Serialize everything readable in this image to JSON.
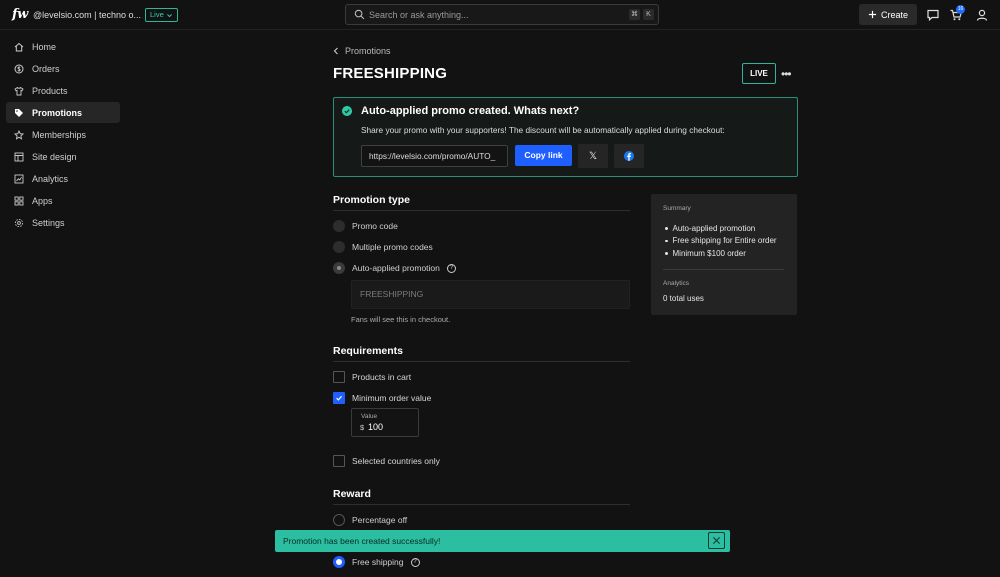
{
  "topbar": {
    "account": "@levelsio.com | techno o...",
    "status_pill": "Live",
    "search_placeholder": "Search or ask anything...",
    "shortcut_keys": [
      "⌘",
      "K"
    ],
    "create_label": "Create",
    "cart_count": "16"
  },
  "sidebar": {
    "items": [
      {
        "label": "Home",
        "icon": "home-icon"
      },
      {
        "label": "Orders",
        "icon": "dollar-icon"
      },
      {
        "label": "Products",
        "icon": "shirt-icon"
      },
      {
        "label": "Promotions",
        "icon": "tag-icon",
        "active": true
      },
      {
        "label": "Memberships",
        "icon": "star-icon"
      },
      {
        "label": "Site design",
        "icon": "layout-icon"
      },
      {
        "label": "Analytics",
        "icon": "chart-icon"
      },
      {
        "label": "Apps",
        "icon": "grid-icon"
      },
      {
        "label": "Settings",
        "icon": "gear-icon"
      }
    ]
  },
  "header": {
    "breadcrumb": "Promotions",
    "title": "FREESHIPPING",
    "live_label": "LIVE"
  },
  "banner": {
    "title": "Auto-applied promo created. Whats next?",
    "description": "Share your promo with your supporters! The discount will be automatically applied during checkout:",
    "url": "https://levelsio.com/promo/AUTO_",
    "copy_label": "Copy link"
  },
  "promotion_type": {
    "title": "Promotion type",
    "options": [
      "Promo code",
      "Multiple promo codes",
      "Auto-applied promotion"
    ],
    "selected": "Auto-applied promotion",
    "code_placeholder": "FREESHIPPING",
    "hint": "Fans will see this in checkout."
  },
  "requirements": {
    "title": "Requirements",
    "products_in_cart": "Products in cart",
    "minimum_order": "Minimum order value",
    "value_label": "Value",
    "currency": "$",
    "value": "100",
    "countries": "Selected countries only"
  },
  "reward": {
    "title": "Reward",
    "percentage": "Percentage off",
    "free_shipping": "Free shipping"
  },
  "summary": {
    "caption": "Summary",
    "items": [
      "Auto-applied promotion",
      "Free shipping for Entire order",
      "Minimum $100 order"
    ],
    "analytics_caption": "Analytics",
    "total_uses": "0 total uses"
  },
  "toast": {
    "message": "Promotion has been created successfully!"
  },
  "colors": {
    "accent": "#1f5eff",
    "success": "#2bbea0",
    "background": "#121212"
  }
}
